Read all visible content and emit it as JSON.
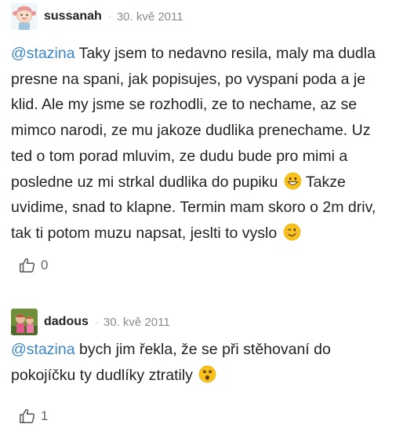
{
  "comments": [
    {
      "author": "sussanah",
      "date": "30. kvě 2011",
      "mention": "@stazina",
      "lines": [
        " Taky jsem to nedavno resila, maly ma dudla",
        "presne na spani, jak popisujes, po vyspani poda a je",
        "klid. Ale my jsme se rozhodli, ze to nechame, az se",
        "mimco narodi, ze mu jakoze dudlika prenechame. Uz",
        "ted o tom porad mluvim, ze dudu bude pro mimi a",
        "posledne uz mi strkal dudlika do pupiku",
        " Takze",
        "uvidime, snad to klapne. Termin mam skoro o 2m driv,",
        "tak ti potom muzu napsat, jeslti to vyslo"
      ],
      "emoji1": "grinning-face",
      "emoji2": "winking-face",
      "likes": "0"
    },
    {
      "author": "dadous",
      "date": "30. kvě 2011",
      "mention": "@stazina",
      "lines": [
        " bych jim řekla, že se při stěhovaní do",
        "pokojíčku ty dudlíky ztratily"
      ],
      "emoji1": "dizzy-face",
      "likes": "1"
    }
  ],
  "separator": "·",
  "colors": {
    "accent": "#3b86c6",
    "muted": "#8c8c8c",
    "text": "#222222"
  }
}
